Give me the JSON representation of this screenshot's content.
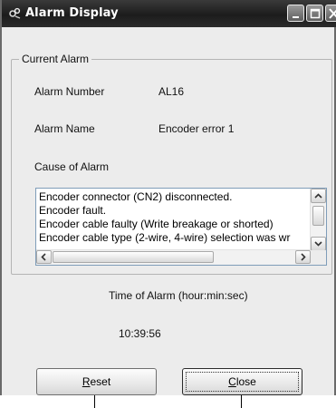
{
  "window": {
    "title": "Alarm Display",
    "icons": {
      "app": "alarm-app-icon",
      "minimize": "minimize-icon",
      "maximize": "maximize-icon",
      "close": "close-icon"
    }
  },
  "current_alarm": {
    "group_label": "Current Alarm",
    "alarm_number_label": "Alarm Number",
    "alarm_number_value": "AL16",
    "alarm_name_label": "Alarm Name",
    "alarm_name_value": "Encoder error 1",
    "cause_label": "Cause of Alarm",
    "cause_lines": [
      "Encoder connector (CN2) disconnected.",
      "Encoder fault.",
      "Encoder cable faulty (Write breakage or shorted)",
      "Encoder cable type (2-wire, 4-wire) selection was wr"
    ]
  },
  "time_of_alarm": {
    "label": "Time of Alarm (hour:min:sec)",
    "value": "10:39:56"
  },
  "buttons": {
    "reset": {
      "mnemonic": "R",
      "rest": "eset"
    },
    "close": {
      "mnemonic": "C",
      "rest": "lose"
    }
  }
}
